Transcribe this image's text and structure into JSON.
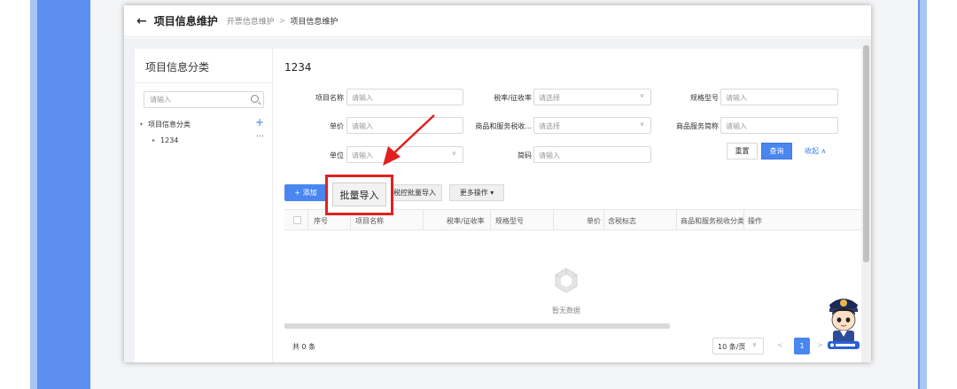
{
  "header": {
    "back_icon": "arrow-left-icon",
    "title": "项目信息维护",
    "breadcrumb_parent": "开票信息维护",
    "breadcrumb_sep": ">",
    "breadcrumb_current": "项目信息维护"
  },
  "sidebar": {
    "title": "项目信息分类",
    "search_placeholder": "请输入",
    "tree": [
      {
        "label": "项目信息分类"
      },
      {
        "label": "1234"
      }
    ],
    "add_symbol": "+",
    "more_symbol": "···"
  },
  "main": {
    "title": "1234",
    "filters": [
      {
        "label": "项目名称",
        "placeholder": "请输入"
      },
      {
        "label": "税率/征收率",
        "placeholder": "请选择"
      },
      {
        "label": "规格型号",
        "placeholder": "请输入"
      },
      {
        "label": "单价",
        "placeholder": "请输入"
      },
      {
        "label": "商品和服务税收...",
        "placeholder": "请选择"
      },
      {
        "label": "商品服务简称",
        "placeholder": "请输入"
      },
      {
        "label": "单位",
        "placeholder": "请输入"
      },
      {
        "label": "简码",
        "placeholder": "请输入"
      }
    ],
    "reset_label": "重置",
    "query_label": "查询",
    "collapse_label": "收起 ∧",
    "add_label": "+ 添加",
    "tax_import_label": "税控批量导入",
    "more_ops_label": "更多操作 ▾",
    "columns": [
      "序号",
      "项目名称",
      "税率/征收率",
      "规格型号",
      "单价",
      "含税标志",
      "商品和服务税收分类",
      "操作"
    ],
    "empty_text": "暂无数据",
    "total_text": "共 0 条",
    "page_size": "10 条/页",
    "page_number": "1",
    "prev_symbol": "<",
    "next_symbol": ">"
  },
  "popup": {
    "label": "批量导入"
  },
  "colors": {
    "accent": "#4a86f0",
    "highlight": "#e02020",
    "frame": "#5d8ff0"
  }
}
